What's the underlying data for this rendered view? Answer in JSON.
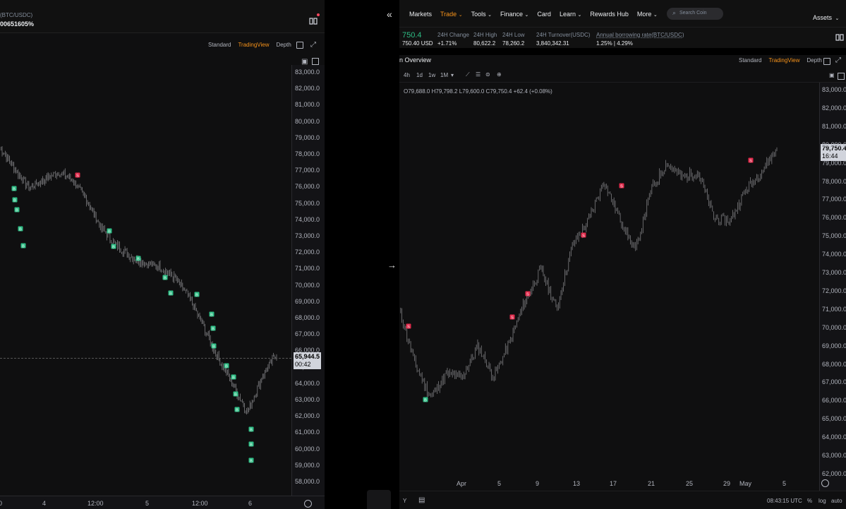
{
  "left_window": {
    "pair": "(BTC/USDC)",
    "rate": "00651605%",
    "views": [
      "Standard",
      "TradingView",
      "Depth"
    ],
    "active_view": "TradingView",
    "y_ticks": [
      "83,000.0",
      "82,000.0",
      "81,000.0",
      "80,000.0",
      "79,000.0",
      "78,000.0",
      "77,000.0",
      "76,000.0",
      "75,000.0",
      "74,000.0",
      "73,000.0",
      "72,000.0",
      "71,000.0",
      "70,000.0",
      "69,000.0",
      "68,000.0",
      "67,000.0",
      "66,000.0",
      "65,000.0",
      "64,000.0",
      "63,000.0",
      "62,000.0",
      "61,000.0",
      "60,000.0",
      "59,000.0",
      "58,000.0"
    ],
    "x_ticks": [
      "0",
      "4",
      "12:00",
      "5",
      "12:00",
      "6"
    ],
    "last_price": "65,944.5",
    "countdown": "00:42",
    "buy_label": "B",
    "sell_label": "S"
  },
  "divider": {
    "collapse_glyph": "«",
    "arrow_glyph": "→"
  },
  "right_window": {
    "nav": [
      "Markets",
      "Trade",
      "Tools",
      "Finance",
      "Card",
      "Learn",
      "Rewards Hub",
      "More"
    ],
    "active_nav": "Trade",
    "search_placeholder": "Search Coin",
    "assets": "Assets",
    "price": "750.4",
    "price_sub": "750.40 USD",
    "stats": [
      {
        "label": "24H Change",
        "value": "+1.71%"
      },
      {
        "label": "24H High",
        "value": "80,622.2"
      },
      {
        "label": "24H Low",
        "value": "78,260.2"
      },
      {
        "label": "24H Turnover(USDC)",
        "value": "3,840,342.31"
      },
      {
        "label": "Annual borrowing rate(BTC/USDC)",
        "value": "1.25% | 4.29%"
      }
    ],
    "section_title": "n Overview",
    "views": [
      "Standard",
      "TradingView",
      "Depth"
    ],
    "active_view": "TradingView",
    "intervals": [
      "4h",
      "1d",
      "1w",
      "1M"
    ],
    "ohlc": "O79,688.0 H79,798.2 L79,600.0 C79,750.4 +62.4 (+0.08%)",
    "y_ticks": [
      "83,000.0",
      "82,000.0",
      "81,000.0",
      "80,000.0",
      "79,000.0",
      "78,000.0",
      "77,000.0",
      "76,000.0",
      "75,000.0",
      "74,000.0",
      "73,000.0",
      "72,000.0",
      "71,000.0",
      "70,000.0",
      "69,000.0",
      "68,000.0",
      "67,000.0",
      "66,000.0",
      "65,000.0",
      "64,000.0",
      "63,000.0",
      "62,000.0"
    ],
    "x_ticks": [
      "Apr",
      "5",
      "9",
      "13",
      "17",
      "21",
      "25",
      "29",
      "May",
      "5"
    ],
    "last_price": "79,750.4",
    "countdown": "16:44",
    "bottom_left": "Y",
    "clock": "08:43:15 UTC",
    "bottom_opts": [
      "%",
      "log",
      "auto"
    ],
    "buy_label": "B",
    "sell_label": "S"
  },
  "colors": {
    "accent": "#f7931a",
    "up": "#2ebd85",
    "down": "#f6465d",
    "buy_marker": "#2ebd85",
    "sell_marker": "#e0294a"
  }
}
